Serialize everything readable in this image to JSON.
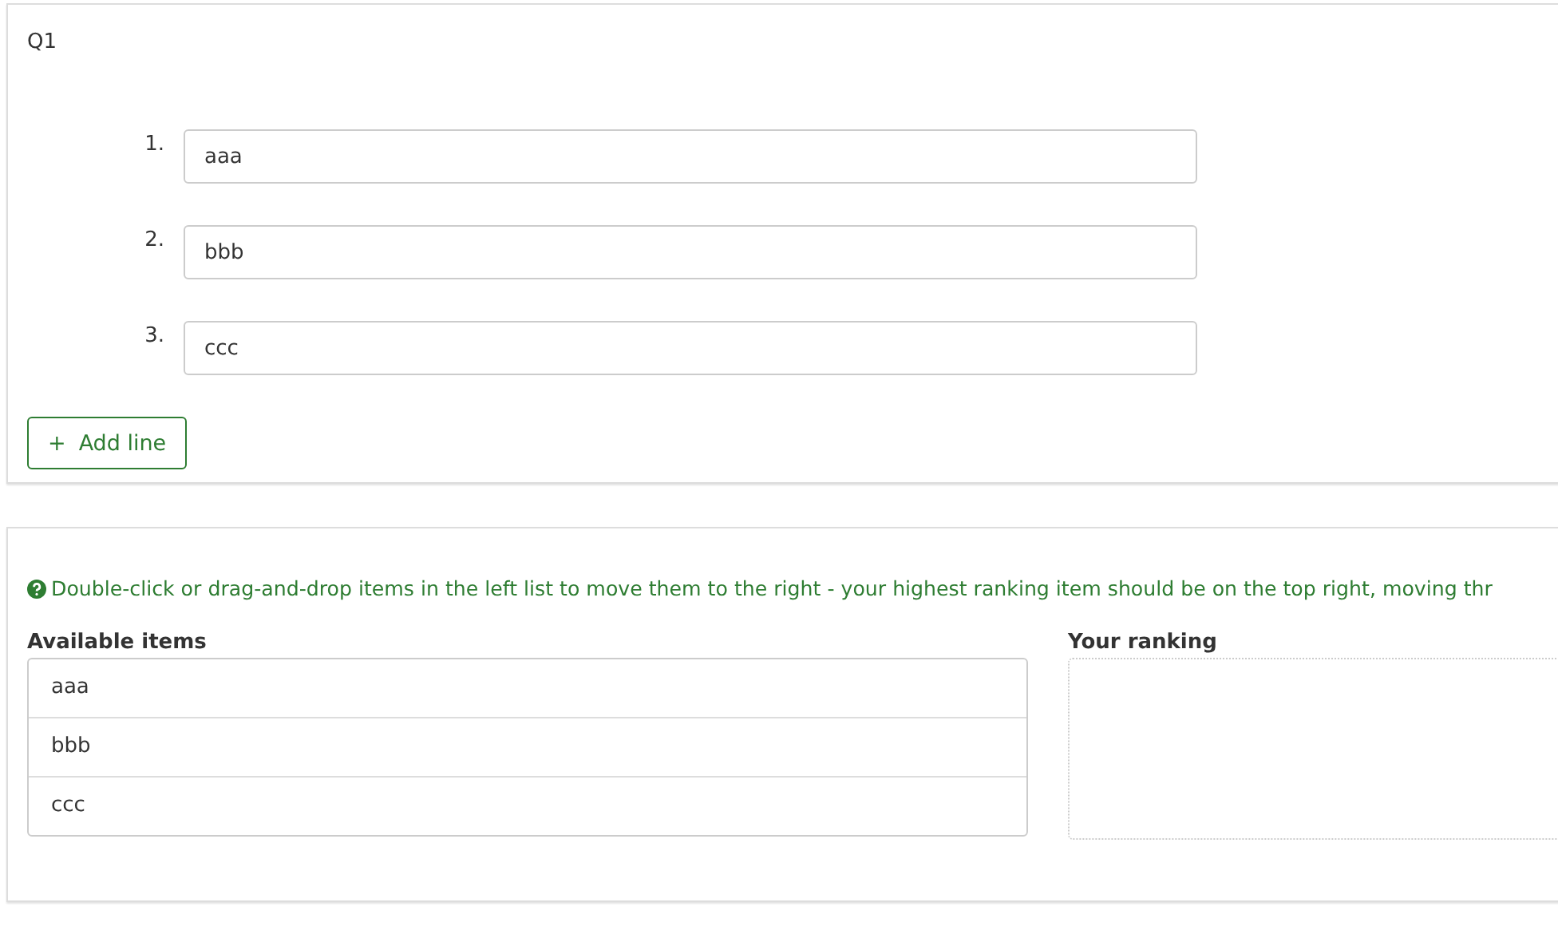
{
  "question": {
    "title": "Q1",
    "lines": [
      {
        "number": "1.",
        "value": "aaa"
      },
      {
        "number": "2.",
        "value": "bbb"
      },
      {
        "number": "3.",
        "value": "ccc"
      }
    ],
    "add_button": {
      "icon": "+",
      "label": "Add line"
    }
  },
  "ranking": {
    "hint": "Double-click or drag-and-drop items in the left list to move them to the right - your highest ranking item should be on the top right, moving thr",
    "available_title": "Available items",
    "available_items": [
      "aaa",
      "bbb",
      "ccc"
    ],
    "ranking_title": "Your ranking"
  }
}
